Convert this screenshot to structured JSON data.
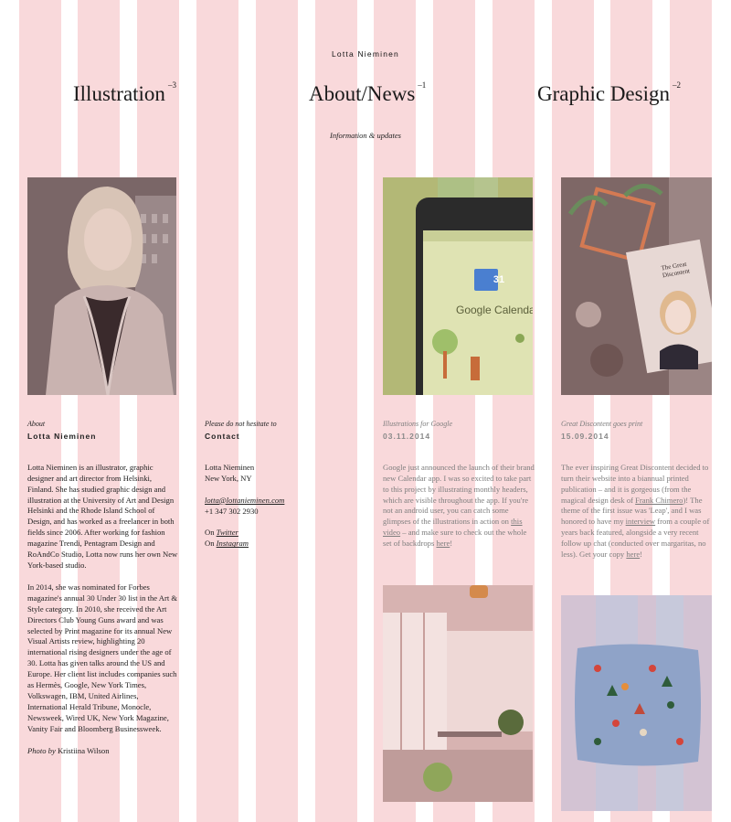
{
  "site": {
    "title": "Lotta Nieminen"
  },
  "nav": {
    "illustration": {
      "label": "Illustration",
      "count": "–3"
    },
    "about": {
      "label": "About/News",
      "count": "–1"
    },
    "graphic": {
      "label": "Graphic Design",
      "count": "–2"
    },
    "tagline": "Information & updates"
  },
  "colors": {
    "grid": "#f9d9db",
    "background": "#ffffff"
  },
  "about": {
    "kicker": "About",
    "heading": "Lotta Nieminen",
    "p1": "Lotta Nieminen is an illustrator, graphic designer and art director from Helsinki, Finland. She has studied graphic design and illustration at the University of Art and Design Helsinki and the Rhode Island School of Design, and has worked as a freelancer in both fields since 2006. After working for fashion magazine Trendi, Pentagram Design and RoAndCo Studio, Lotta now runs her own New York-based studio.",
    "p2": "In 2014, she was nominated for Forbes magazine's annual 30 Under 30 list in the Art & Style category. In 2010, she received the Art Directors Club Young Guns award and was selected by Print magazine for its annual New Visual Artists review, highlighting 20 international rising designers under the age of 30. Lotta has given talks around the US and Europe. Her client list includes companies such as Hermès, Google, New York Times, Volkswagen, IBM, United Airlines, International Herald Tribune, Monocle, Newsweek, Wired UK, New York Magazine, Vanity Fair and Bloomberg Businessweek.",
    "photo_credit_prefix": "Photo by",
    "photo_credit_name": "Kristiina Wilson"
  },
  "contact": {
    "kicker": "Please do not hesitate to",
    "heading": "Contact",
    "name": "Lotta Nieminen",
    "city": "New York, NY",
    "email": "lotta@lottanieminen.com",
    "phone": "+1 347 302 2930",
    "on": "On",
    "twitter": "Twitter",
    "instagram": "Instagram"
  },
  "news1": {
    "kicker": "Illustrations for Google",
    "date": "03.11.2014",
    "text_a": "Google just announced the launch of their brand new Calendar app. I was so excited to take part to this project by illustrating monthly headers, which are visible throughout the app. If you're not an android user, you can catch some glimpses of the illustrations in action on",
    "link1": "this video",
    "text_b": "– and make sure to check out the whole set of backdrops",
    "link2": "here",
    "text_c": "!",
    "phone_day": "31",
    "phone_app": "Google Calenda"
  },
  "news2": {
    "kicker": "Great Discontent goes print",
    "date": "15.09.2014",
    "text_a": "The ever inspiring Great Discontent decided to turn their website into a biannual printed publication – and it is gorgeous (from the magical design desk of",
    "link1": "Frank Chimero",
    "text_b": ")! The theme of the first issue was 'Leap', and I was honored to have my",
    "link2": "interview",
    "text_c": "from a couple of years back featured, alongside a very recent follow up chat (conducted over margaritas, no less). Get your copy",
    "link3": "here",
    "text_d": "!",
    "magazine_title": "The Great Discontent"
  }
}
